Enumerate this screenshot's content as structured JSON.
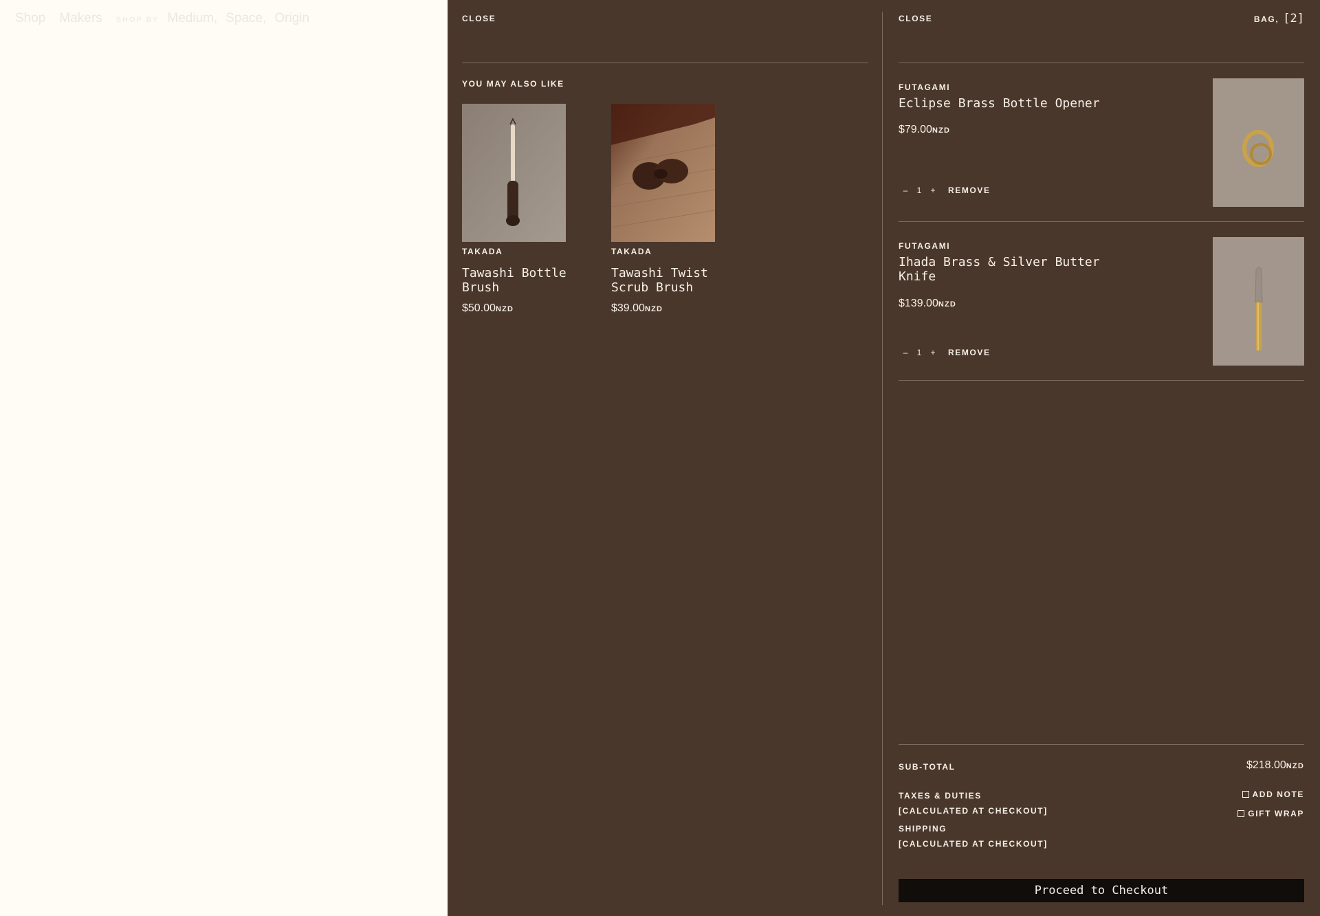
{
  "nav": {
    "shop": "Shop",
    "makers": "Makers",
    "shop_by_label": "SHOP BY",
    "shop_by_links": [
      "Medium,",
      "Space,",
      "Origin"
    ]
  },
  "recommendations": {
    "close_label": "CLOSE",
    "title": "YOU MAY ALSO LIKE",
    "products": [
      {
        "maker": "TAKADA",
        "name": "Tawashi Bottle Brush",
        "price": "$50.00",
        "currency": "NZD"
      },
      {
        "maker": "TAKADA",
        "name": "Tawashi Twist Scrub Brush",
        "price": "$39.00",
        "currency": "NZD"
      }
    ]
  },
  "bag": {
    "close_label": "CLOSE",
    "bag_label": "BAG,",
    "count": "[2]",
    "items": [
      {
        "maker": "FUTAGAMI",
        "name": "Eclipse Brass Bottle Opener",
        "price": "$79.00",
        "currency": "NZD",
        "minus": "–",
        "qty": "1",
        "plus": "+",
        "remove": "REMOVE"
      },
      {
        "maker": "FUTAGAMI",
        "name": "Ihada Brass & Silver Butter Knife",
        "price": "$139.00",
        "currency": "NZD",
        "minus": "–",
        "qty": "1",
        "plus": "+",
        "remove": "REMOVE"
      }
    ],
    "summary": {
      "subtotal_label": "SUB-TOTAL",
      "subtotal_value": "$218.00",
      "subtotal_currency": "NZD",
      "taxes_label": "TAXES & DUTIES",
      "taxes_note": "[CALCULATED AT CHECKOUT]",
      "shipping_label": "SHIPPING",
      "shipping_note": "[CALCULATED AT CHECKOUT]",
      "add_note": "ADD NOTE",
      "gift_wrap": "GIFT WRAP"
    },
    "checkout_label": "Proceed to Checkout"
  },
  "colors": {
    "drawer_bg": "#4a372b",
    "page_bg": "#fffcf5",
    "checkout_bg": "#100d0b",
    "text": "#f5efe6"
  }
}
